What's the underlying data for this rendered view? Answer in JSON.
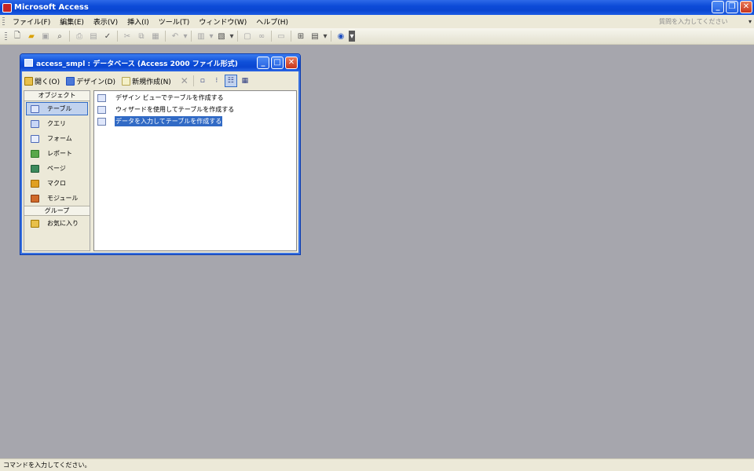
{
  "app": {
    "title": "Microsoft Access"
  },
  "menu": {
    "items": [
      "ファイル(F)",
      "編集(E)",
      "表示(V)",
      "挿入(I)",
      "ツール(T)",
      "ウィンドウ(W)",
      "ヘルプ(H)"
    ],
    "help_placeholder": "質問を入力してください"
  },
  "dbwindow": {
    "title": "access_smpl : データベース (Access 2000 ファイル形式)",
    "toolbar": {
      "open": "開く(O)",
      "design": "デザイン(D)",
      "new": "新規作成(N)"
    },
    "objects_header": "オブジェクト",
    "objects": [
      "テーブル",
      "クエリ",
      "フォーム",
      "レポート",
      "ページ",
      "マクロ",
      "モジュール"
    ],
    "groups_header": "グループ",
    "groups": [
      "お気に入り"
    ],
    "list": [
      "デザイン ビューでテーブルを作成する",
      "ウィザードを使用してテーブルを作成する",
      "データを入力してテーブルを作成する"
    ]
  },
  "status": {
    "text": "コマンドを入力してください。"
  },
  "colors": {
    "title_blue": "#0a46d1",
    "workspace": "#a6a6ad",
    "selection": "#316ac5"
  }
}
